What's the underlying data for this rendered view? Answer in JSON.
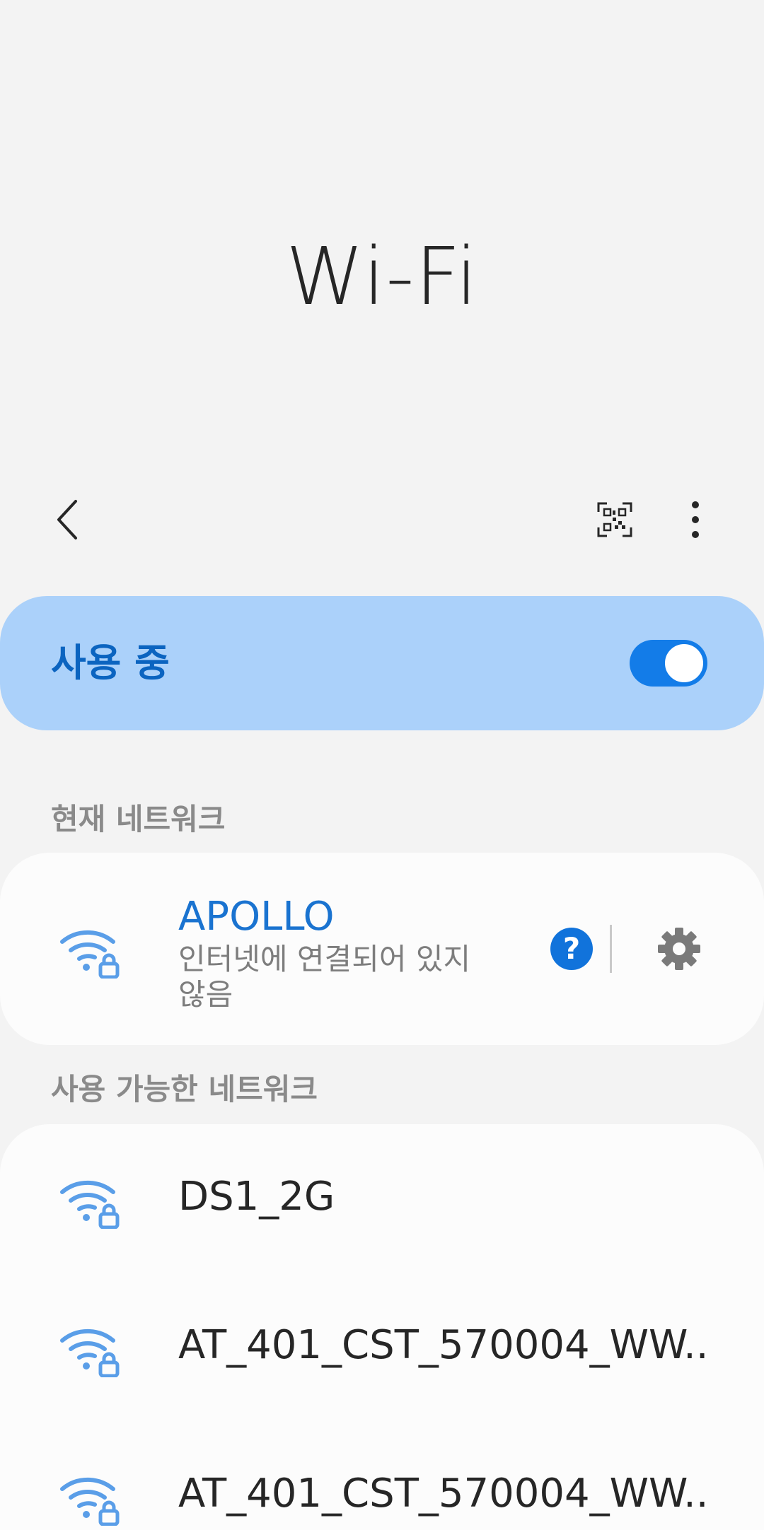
{
  "page": {
    "title": "Wi-Fi"
  },
  "toolbar": {
    "back_icon": "chevron-left-icon",
    "qr_icon": "qr-code-icon",
    "more_icon": "more-vert-icon"
  },
  "master_switch": {
    "label": "사용 중",
    "state": true
  },
  "current_network": {
    "section_label": "현재 네트워크",
    "name": "APOLLO",
    "status": "인터넷에 연결되어 있지 않음",
    "help_icon": "help-icon",
    "settings_icon": "gear-icon"
  },
  "available_networks": {
    "section_label": "사용 가능한 네트워크",
    "items": [
      {
        "name": "DS1_2G",
        "icon": "wifi-locked-icon"
      },
      {
        "name": "AT_401_CST_570004_WW..",
        "icon": "wifi-locked-icon"
      },
      {
        "name": "AT_401_CST_570004_WW..",
        "icon": "wifi-locked-icon"
      }
    ]
  },
  "colors": {
    "accent": "#137ce8",
    "switch_bar": "#abd1fa",
    "switch_label": "#0b64c0",
    "wifi_icon": "#5a9ee8",
    "background": "#f3f3f3"
  }
}
